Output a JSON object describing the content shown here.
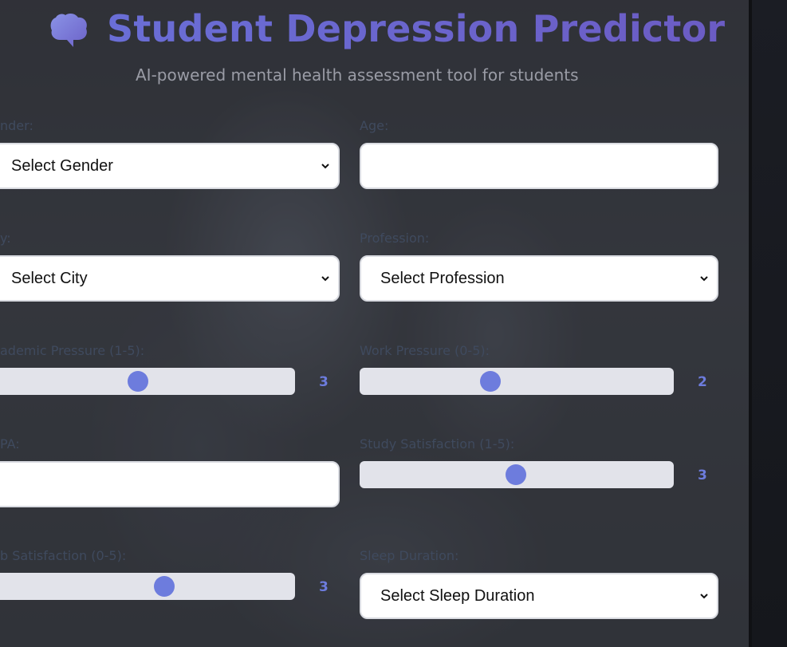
{
  "header": {
    "title": "Student Depression Predictor",
    "subtitle": "AI-powered mental health assessment tool for students",
    "icon": "brain-icon",
    "accent_color": "#6b63c9"
  },
  "form": {
    "gender": {
      "label": "nder:",
      "value": "Select Gender"
    },
    "age": {
      "label": "Age:",
      "value": ""
    },
    "city": {
      "label": "y:",
      "value": "Select City"
    },
    "profession": {
      "label": "Profession:",
      "value": "Select Profession"
    },
    "academic_pressure": {
      "label": "ademic Pressure (1-5):",
      "value": "3",
      "fill": 0.62
    },
    "work_pressure": {
      "label": "Work Pressure (0-5):",
      "value": "2",
      "fill": 0.4
    },
    "cgpa": {
      "label": "PA:",
      "value": ""
    },
    "study_satisfaction": {
      "label": "Study Satisfaction (1-5):",
      "value": "3",
      "fill": 0.5
    },
    "job_satisfaction": {
      "label": "b Satisfaction (0-5):",
      "value": "3",
      "fill": 0.6
    },
    "sleep_duration": {
      "label": "Sleep Duration:",
      "value": "Select Sleep Duration"
    }
  },
  "colors": {
    "slider_thumb": "#6d7cdd",
    "slider_track": "#e2e3ea",
    "field_bg": "#ffffff"
  }
}
